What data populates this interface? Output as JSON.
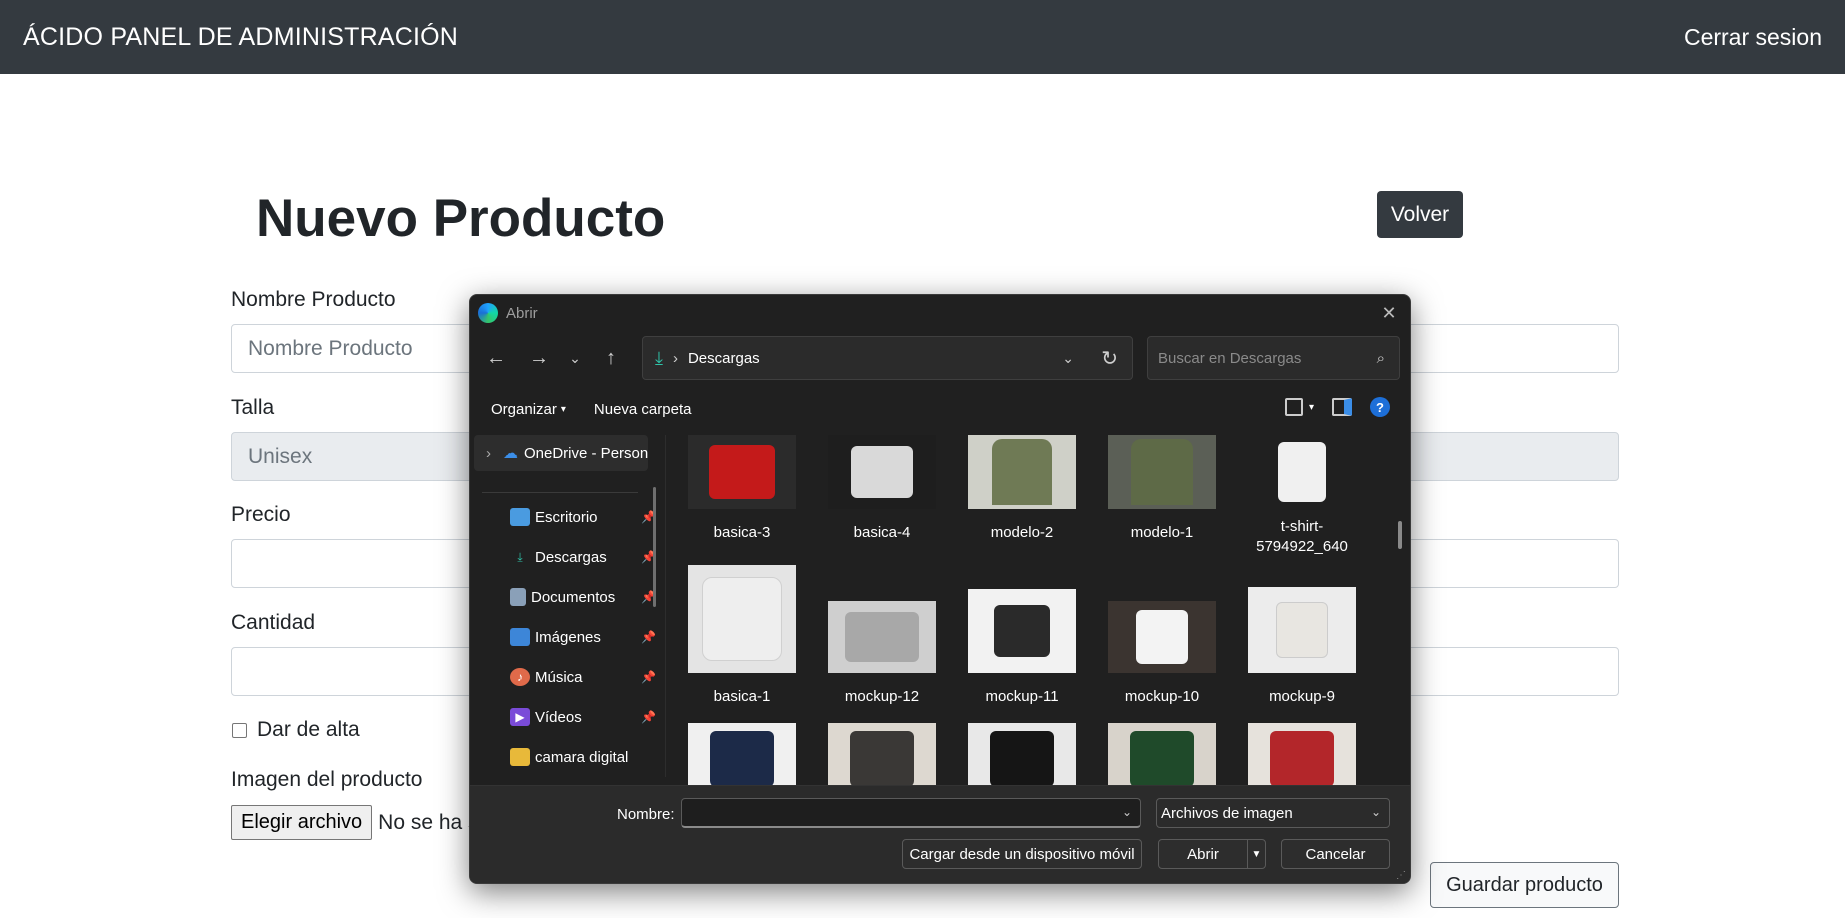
{
  "navbar": {
    "brand": "ÁCIDO PANEL DE ADMINISTRACIÓN",
    "logout": "Cerrar sesion"
  },
  "form": {
    "title": "Nuevo Producto",
    "back_label": "Volver",
    "name_label": "Nombre Producto",
    "name_placeholder": "Nombre Producto",
    "size_label": "Talla",
    "size_value": "Unisex",
    "price_label": "Precio",
    "quantity_label": "Cantidad",
    "active_label": "Dar de alta",
    "image_label": "Imagen del producto",
    "file_button": "Elegir archivo",
    "file_status": "No se ha seleccionado ningún archivo",
    "save_label": "Guardar producto"
  },
  "dialog": {
    "title": "Abrir",
    "address": "Descargas",
    "search_placeholder": "Buscar en Descargas",
    "organize": "Organizar",
    "new_folder": "Nueva carpeta",
    "onedrive": "OneDrive - Personal",
    "nav_items": [
      {
        "label": "Escritorio",
        "icon": "desktop-icon"
      },
      {
        "label": "Descargas",
        "icon": "download-icon"
      },
      {
        "label": "Documentos",
        "icon": "document-icon"
      },
      {
        "label": "Imágenes",
        "icon": "pictures-icon"
      },
      {
        "label": "Música",
        "icon": "music-icon"
      },
      {
        "label": "Vídeos",
        "icon": "video-icon"
      },
      {
        "label": "camara digital",
        "icon": "folder-icon"
      }
    ],
    "files": [
      {
        "name": "basica-3",
        "color": "#c41a1a"
      },
      {
        "name": "basica-4",
        "color": "#d9d9d9"
      },
      {
        "name": "modelo-2",
        "color": "#6f7a55"
      },
      {
        "name": "modelo-1",
        "color": "#5e6a47"
      },
      {
        "name": "t-shirt-5794922_640",
        "color": "#f0f0f0"
      },
      {
        "name": "basica-1",
        "color": "#eeeeee"
      },
      {
        "name": "mockup-12",
        "color": "#a8a8a8"
      },
      {
        "name": "mockup-11",
        "color": "#2a2a2a"
      },
      {
        "name": "mockup-10",
        "color": "#8a6e4b"
      },
      {
        "name": "mockup-9",
        "color": "#e8e6e1"
      },
      {
        "name": "",
        "color": "#1c2a48"
      },
      {
        "name": "",
        "color": "#3a3836"
      },
      {
        "name": "",
        "color": "#151515"
      },
      {
        "name": "",
        "color": "#1f4a2a"
      },
      {
        "name": "",
        "color": "#b3262a"
      }
    ],
    "name_field_label": "Nombre:",
    "name_value": "",
    "file_type": "Archivos de imagen",
    "mobile_button": "Cargar desde un dispositivo móvil",
    "open_button": "Abrir",
    "cancel_button": "Cancelar"
  }
}
